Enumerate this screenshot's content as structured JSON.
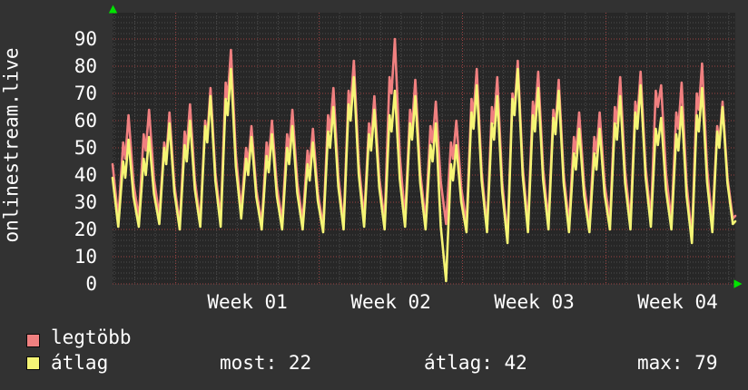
{
  "page": {
    "outer_bg": "#323232",
    "text_color": "#ffffff"
  },
  "chart_data": {
    "type": "line",
    "title": "",
    "ylabel": "onlinestream.live",
    "xlabel": "",
    "ylim": [
      0,
      100
    ],
    "y_ticks": [
      0,
      10,
      20,
      30,
      40,
      50,
      60,
      70,
      80,
      90
    ],
    "x_week_labels": [
      "Week 01",
      "Week 02",
      "Week 03",
      "Week 04"
    ],
    "grid": {
      "canvas_bg": "#272727",
      "minor_color": "#4e4e4e",
      "major_color": "#9c4343",
      "arrow_color": "#00e400",
      "minor_y_step": 2,
      "major_y_step": 10,
      "minor_x_unit": "day",
      "major_x_unit": "week"
    },
    "x_axis": {
      "days_total": 30.4,
      "first_day_line_offset": 0.085,
      "week_line_days": [
        3.085,
        10.085,
        17.085,
        24.085
      ]
    },
    "series": [
      {
        "name": "legtöbb",
        "color": "#f08080",
        "edge_start": 44,
        "days_trough_shoulder_peak": [
          [
            24,
            52,
            62
          ],
          [
            24,
            55,
            64
          ],
          [
            25,
            52,
            63
          ],
          [
            22,
            56,
            66
          ],
          [
            23,
            60,
            72
          ],
          [
            24,
            74,
            86
          ],
          [
            27,
            50,
            58
          ],
          [
            22,
            52,
            60
          ],
          [
            23,
            55,
            64
          ],
          [
            23,
            49,
            57
          ],
          [
            21,
            62,
            72
          ],
          [
            22,
            71,
            82
          ],
          [
            24,
            59,
            69
          ],
          [
            23,
            76,
            90
          ],
          [
            24,
            64,
            75
          ],
          [
            23,
            58,
            67
          ],
          [
            22,
            52,
            60
          ],
          [
            22,
            68,
            79
          ],
          [
            21,
            65,
            76
          ],
          [
            17,
            70,
            82
          ],
          [
            22,
            67,
            78
          ],
          [
            23,
            64,
            75
          ],
          [
            22,
            54,
            63
          ],
          [
            22,
            54,
            63
          ],
          [
            23,
            65,
            76
          ],
          [
            23,
            67,
            78
          ],
          [
            24,
            71,
            73
          ],
          [
            23,
            63,
            74
          ],
          [
            17,
            70,
            81
          ],
          [
            22,
            58,
            67
          ],
          [
            24,
            null,
            null
          ]
        ]
      },
      {
        "name": "átlag",
        "color": "#f5f575",
        "edge_start": 39,
        "days_trough_shoulder_peak": [
          [
            21,
            45,
            53
          ],
          [
            21,
            46,
            54
          ],
          [
            22,
            50,
            59
          ],
          [
            20,
            51,
            60
          ],
          [
            21,
            58,
            69
          ],
          [
            21,
            68,
            79
          ],
          [
            24,
            46,
            54
          ],
          [
            20,
            47,
            55
          ],
          [
            20,
            50,
            58
          ],
          [
            20,
            44,
            52
          ],
          [
            19,
            56,
            65
          ],
          [
            20,
            66,
            76
          ],
          [
            21,
            55,
            64
          ],
          [
            20,
            62,
            71
          ],
          [
            21,
            59,
            69
          ],
          [
            20,
            51,
            59
          ],
          [
            1,
            44,
            51
          ],
          [
            19,
            63,
            73
          ],
          [
            19,
            59,
            69
          ],
          [
            15,
            68,
            79
          ],
          [
            19,
            62,
            72
          ],
          [
            20,
            61,
            71
          ],
          [
            19,
            48,
            57
          ],
          [
            19,
            48,
            57
          ],
          [
            20,
            59,
            69
          ],
          [
            20,
            63,
            73
          ],
          [
            21,
            57,
            61
          ],
          [
            20,
            55,
            65
          ],
          [
            15,
            62,
            72
          ],
          [
            19,
            56,
            65
          ],
          [
            22,
            null,
            null
          ]
        ]
      }
    ],
    "stats": {
      "most": 22,
      "atlag": 42,
      "max": 79
    }
  },
  "legend": {
    "items": [
      {
        "label": "legtöbb",
        "color": "#f08080"
      },
      {
        "label": "átlag",
        "color": "#f5f575"
      }
    ]
  },
  "stats_row": [
    {
      "label": "most:",
      "value": "22"
    },
    {
      "label": "átlag:",
      "value": "42"
    },
    {
      "label": "max:",
      "value": "79"
    }
  ]
}
